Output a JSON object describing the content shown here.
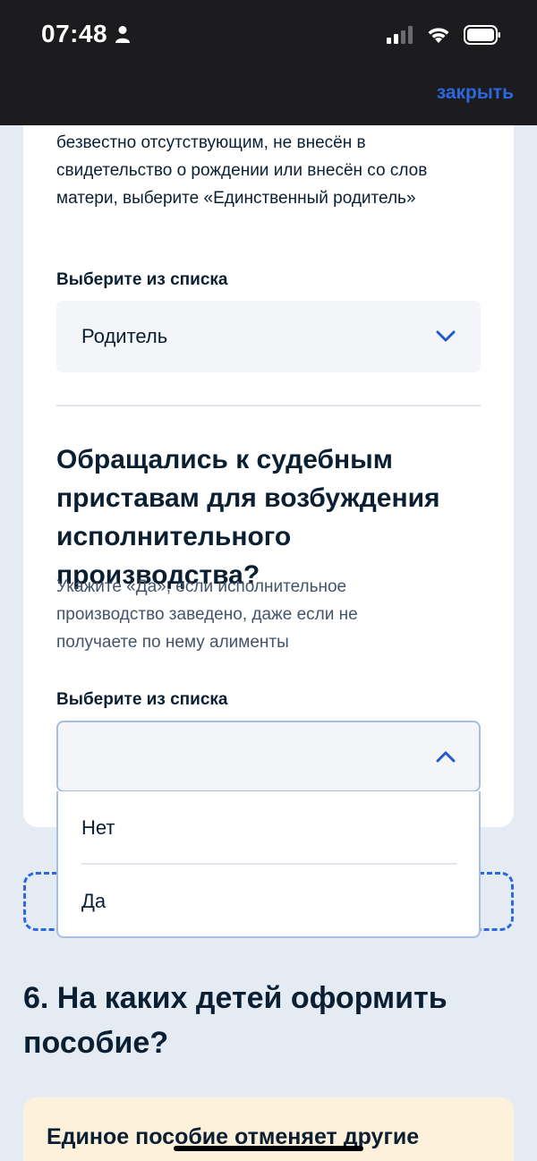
{
  "status_bar": {
    "time": "07:48"
  },
  "header": {
    "close_label": "закрыть"
  },
  "card": {
    "hint_top": "безвестно отсутствующим, не внесён в свидетельство о рождении или внесён со слов матери, выберите «Единственный родитель»",
    "select1": {
      "label": "Выберите из списка",
      "value": "Родитель"
    },
    "question": "Обращались к судебным приставам для возбуждения исполнительного производства?",
    "hint_question": "Укажите «Да», если исполнительное производство заведено, даже если не получаете по нему алименты",
    "select2": {
      "label": "Выберите из списка",
      "value": ""
    },
    "dropdown_options": [
      "Нет",
      "Да"
    ]
  },
  "section": {
    "title": "6. На каких детей оформить пособие?"
  },
  "notice": {
    "text": "Единое пособие отменяет другие"
  },
  "colors": {
    "accent": "#2b68e0",
    "background": "#e4ebf3",
    "notice_bg": "#fdf1dc"
  }
}
